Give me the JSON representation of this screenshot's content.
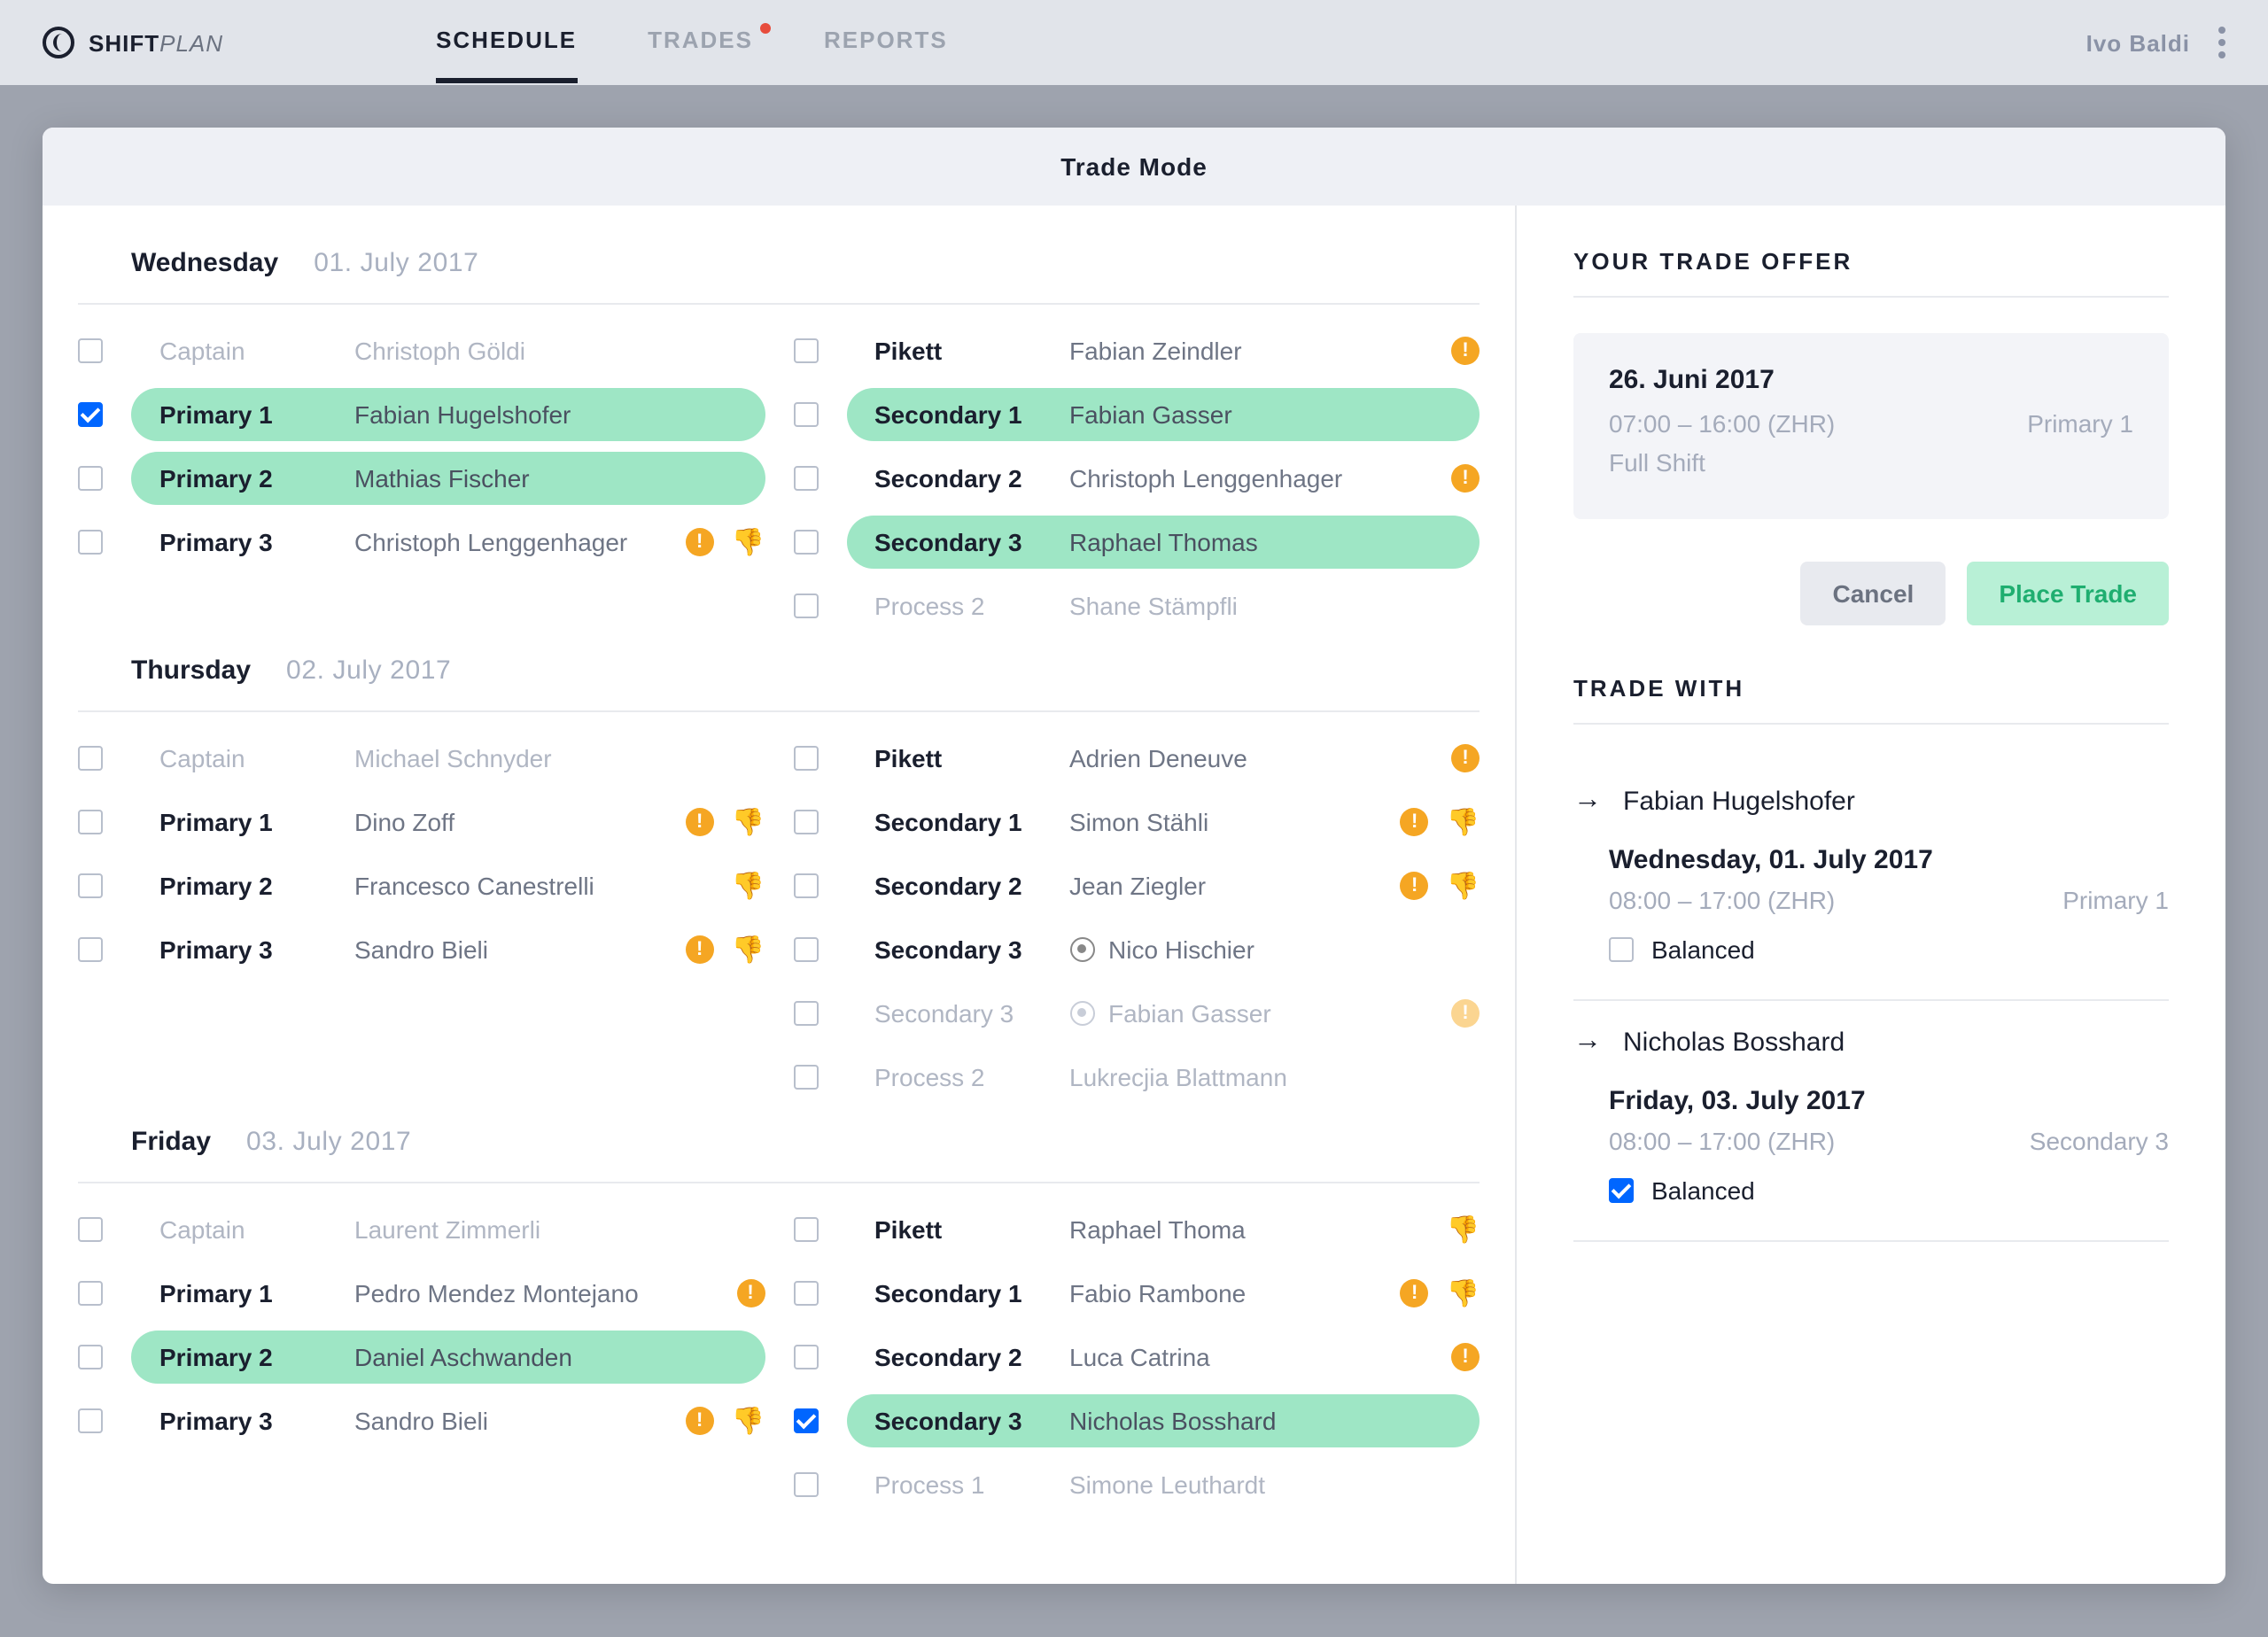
{
  "brand": {
    "bold": "SHIFT",
    "light": "PLAN"
  },
  "nav": {
    "schedule": "SCHEDULE",
    "trades": "TRADES",
    "reports": "REPORTS"
  },
  "user": "Ivo Baldi",
  "modal_title": "Trade Mode",
  "days": {
    "wed": {
      "name": "Wednesday",
      "date": "01. July 2017"
    },
    "thu": {
      "name": "Thursday",
      "date": "02. July 2017"
    },
    "fri": {
      "name": "Friday",
      "date": "03. July 2017"
    }
  },
  "roles": {
    "captain": "Captain",
    "p1": "Primary 1",
    "p2": "Primary 2",
    "p3": "Primary 3",
    "pikett": "Pikett",
    "s1": "Secondary 1",
    "s2": "Secondary 2",
    "s3": "Secondary 3",
    "proc1": "Process 1",
    "proc2": "Process 2"
  },
  "wed": {
    "captain": "Christoph Göldi",
    "p1": "Fabian Hugelshofer",
    "p2": "Mathias Fischer",
    "p3": "Christoph Lenggenhager",
    "pikett": "Fabian Zeindler",
    "s1": "Fabian Gasser",
    "s2": "Christoph Lenggenhager",
    "s3": "Raphael Thomas",
    "proc2": "Shane Stämpfli"
  },
  "thu": {
    "captain": "Michael Schnyder",
    "p1": "Dino Zoff",
    "p2": "Francesco Canestrelli",
    "p3": "Sandro Bieli",
    "pikett": "Adrien Deneuve",
    "s1": "Simon Stähli",
    "s2": "Jean Ziegler",
    "s3a": "Nico Hischier",
    "s3b": "Fabian Gasser",
    "proc2": "Lukrecjia Blattmann"
  },
  "fri": {
    "captain": "Laurent Zimmerli",
    "p1": "Pedro Mendez Montejano",
    "p2": "Daniel Aschwanden",
    "p3": "Sandro Bieli",
    "pikett": "Raphael Thoma",
    "s1": "Fabio Rambone",
    "s2": "Luca Catrina",
    "s3": "Nicholas Bosshard",
    "proc1": "Simone Leuthardt"
  },
  "sidebar": {
    "offer_title": "YOUR TRADE OFFER",
    "offer": {
      "date": "26. Juni 2017",
      "time": "07:00 – 16:00 (ZHR)",
      "role": "Primary 1",
      "shift": "Full Shift"
    },
    "cancel": "Cancel",
    "place": "Place Trade",
    "tradewith_title": "TRADE WITH",
    "t1": {
      "name": "Fabian Hugelshofer",
      "date": "Wednesday, 01. July 2017",
      "time": "08:00 – 17:00 (ZHR)",
      "role": "Primary 1",
      "balanced": "Balanced"
    },
    "t2": {
      "name": "Nicholas Bosshard",
      "date": "Friday, 03. July 2017",
      "time": "08:00 – 17:00 (ZHR)",
      "role": "Secondary 3",
      "balanced": "Balanced"
    }
  }
}
